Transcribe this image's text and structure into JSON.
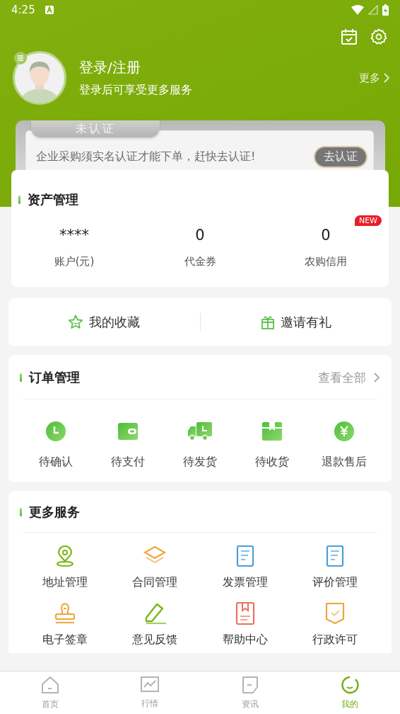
{
  "status_bar": {
    "time": "4:25"
  },
  "profile": {
    "title": "登录/注册",
    "subtitle": "登录后可享受更多服务",
    "more": "更多"
  },
  "certification": {
    "badge": "未认证",
    "message": "企业采购须实名认证才能下单，赶快去认证!",
    "button": "去认证"
  },
  "assets": {
    "title": "资产管理",
    "items": [
      {
        "value": "****",
        "label": "账户(元)"
      },
      {
        "value": "0",
        "label": "代金券"
      },
      {
        "value": "0",
        "label": "农购信用",
        "badge": "NEW"
      }
    ]
  },
  "shortcuts": [
    {
      "label": "我的收藏"
    },
    {
      "label": "邀请有礼"
    }
  ],
  "orders": {
    "title": "订单管理",
    "view_all": "查看全部",
    "items": [
      {
        "label": "待确认"
      },
      {
        "label": "待支付"
      },
      {
        "label": "待发货"
      },
      {
        "label": "待收货"
      },
      {
        "label": "退款售后"
      }
    ]
  },
  "services": {
    "title": "更多服务",
    "items": [
      {
        "label": "地址管理"
      },
      {
        "label": "合同管理"
      },
      {
        "label": "发票管理"
      },
      {
        "label": "评价管理"
      },
      {
        "label": "电子签章"
      },
      {
        "label": "意见反馈"
      },
      {
        "label": "帮助中心"
      },
      {
        "label": "行政许可"
      }
    ]
  },
  "tab_bar": [
    {
      "label": "首页",
      "selected": false
    },
    {
      "label": "行情",
      "selected": false
    },
    {
      "label": "资讯",
      "selected": false
    },
    {
      "label": "我的",
      "selected": true
    }
  ]
}
